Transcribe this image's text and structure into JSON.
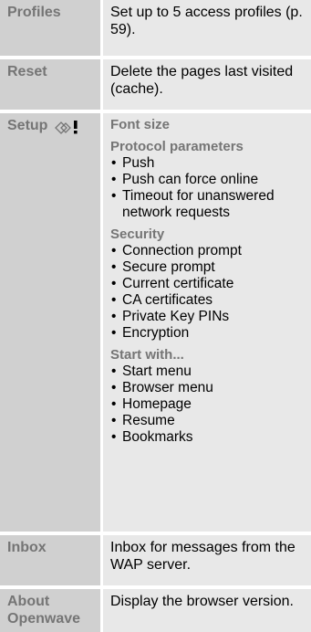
{
  "rows": [
    {
      "label": "Profiles",
      "text": "Set up to 5 access profiles (p. 59)."
    },
    {
      "label": "Reset",
      "text": "Delete the pages last visited (cache)."
    },
    {
      "label": "Setup",
      "icon": "settings-shortcut-icon",
      "sections": [
        {
          "title": "Font size",
          "items": []
        },
        {
          "title": "Protocol parameters",
          "items": [
            "Push",
            "Push can force online",
            "Timeout for unanswered network requests"
          ]
        },
        {
          "title": "Security",
          "items": [
            "Connection prompt",
            "Secure prompt",
            "Current certificate",
            "CA certificates",
            "Private Key PINs",
            "Encryption"
          ]
        },
        {
          "title": "Start with...",
          "items": [
            "Start menu",
            "Browser menu",
            "Homepage",
            "Resume",
            "Bookmarks"
          ]
        }
      ]
    },
    {
      "label": "Inbox",
      "text": "Inbox for messages from the WAP server."
    },
    {
      "label": "About Openwave",
      "text": "Display the browser version."
    }
  ]
}
